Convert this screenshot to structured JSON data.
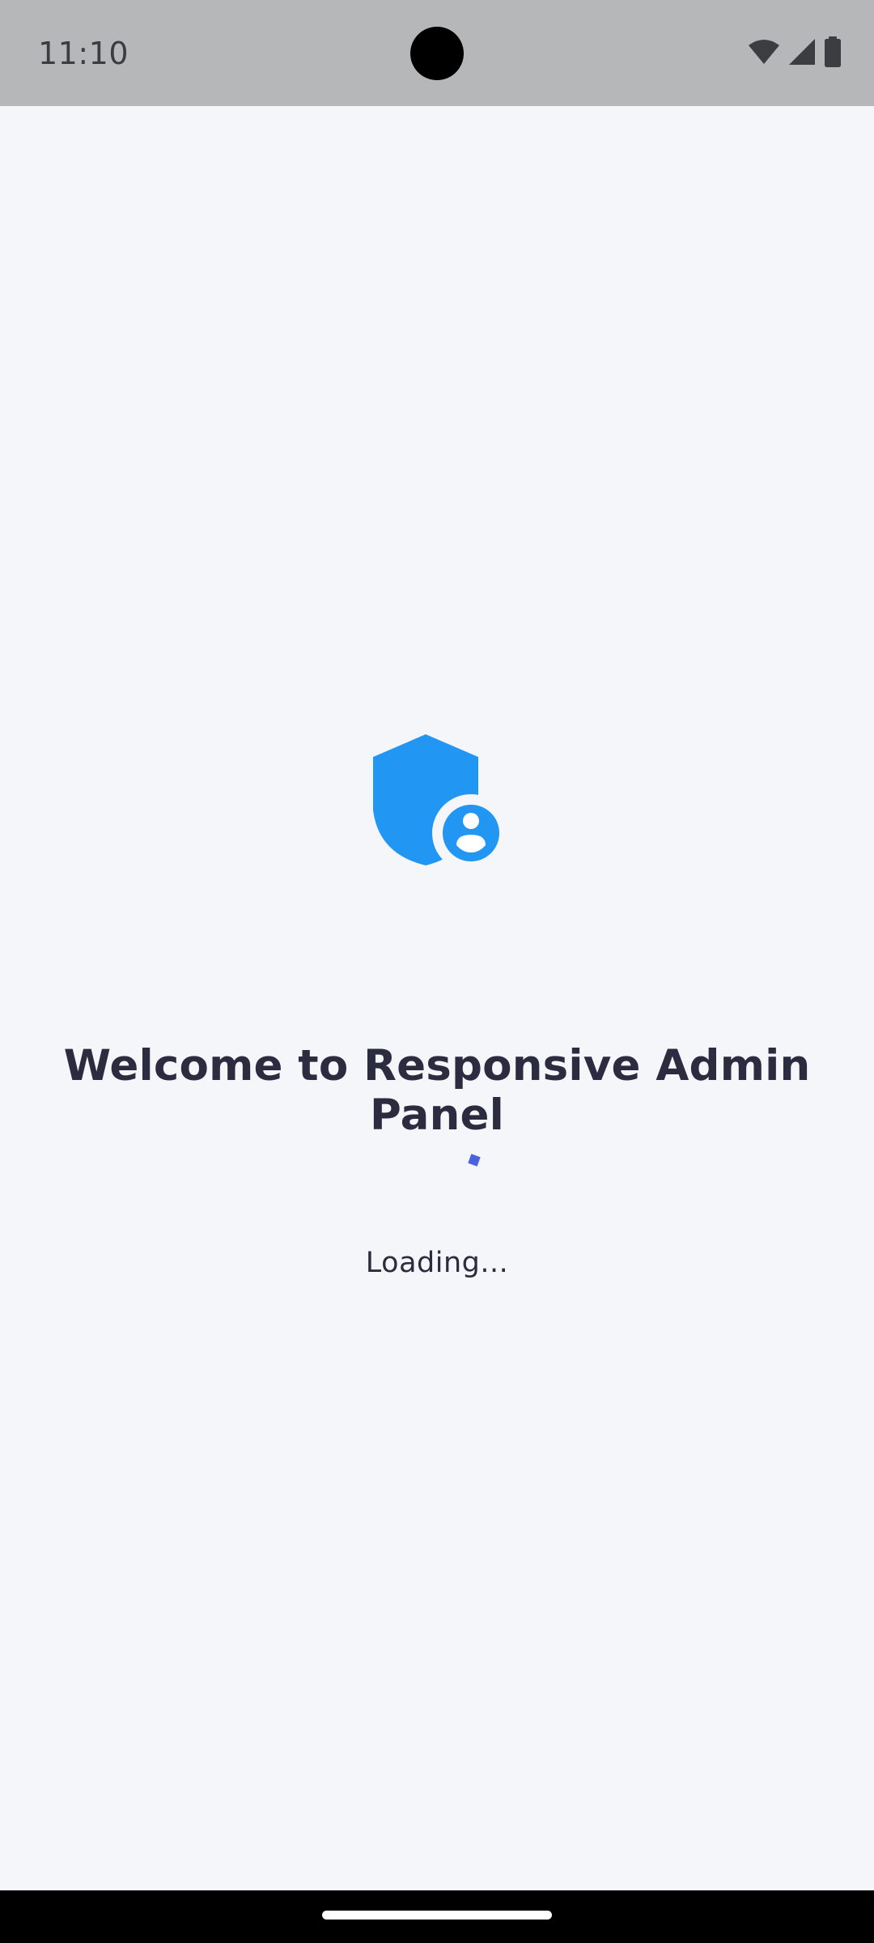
{
  "status_bar": {
    "time": "11:10",
    "icons": [
      "wifi-icon",
      "cellular-signal-icon",
      "battery-icon"
    ]
  },
  "splash": {
    "logo_icon": "admin-shield-user-icon",
    "title": "Welcome to Responsive Admin Panel",
    "loading_text": "Loading..."
  },
  "colors": {
    "background": "#f5f6fa",
    "status_bar": "#b6b7b9",
    "logo_blue": "#2196f3",
    "title_text": "#2b2c3f",
    "spinner": "#4a63dc"
  }
}
